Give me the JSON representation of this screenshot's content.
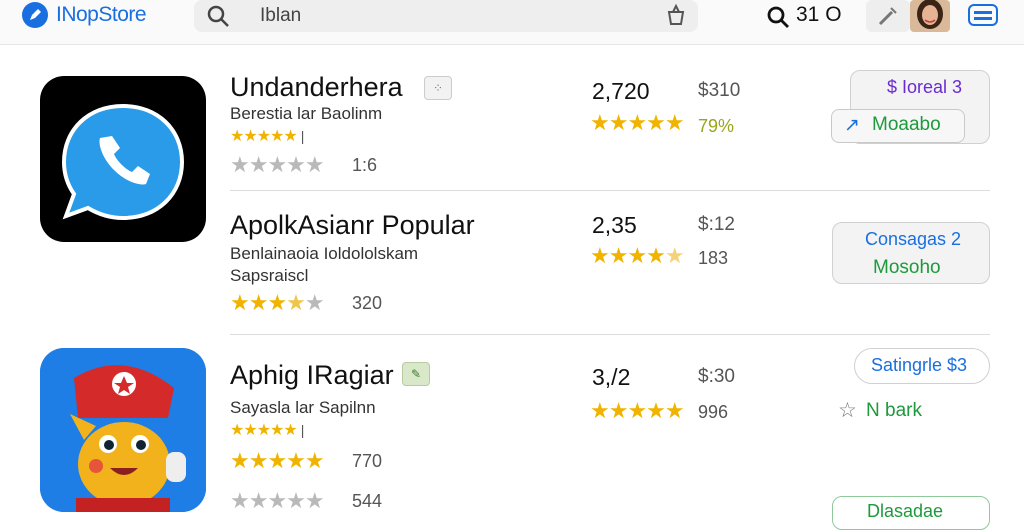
{
  "header": {
    "brand": "INopStore",
    "search": {
      "value": "Iblan"
    },
    "count": "31 O"
  },
  "apps": [
    {
      "name": "Undanderhera",
      "subtitle": "Berestia lar Baolinm",
      "small_stars": "★★★★★",
      "small_stars_extra": "|",
      "grey_stars": "★★★★★",
      "rating_count": "1:6",
      "metric": "2,720",
      "price": "$310",
      "big_stars": "★★★★★",
      "percent": "79%",
      "secondary_button": "$ Ioreal 3",
      "primary_button": "Moaabo"
    },
    {
      "name": "ApolkAsianr Popular",
      "subtitle": "Benlainaoia Ioldololskam",
      "subtitle2": "Sapsraiscl",
      "stars_filled": "★★★",
      "stars_half": "★",
      "stars_empty": "★",
      "rating_count": "320",
      "metric": "2,35",
      "price": "$:12",
      "big_stars_filled": "★★★★",
      "big_stars_half": "★",
      "sub_count": "183",
      "button_line1": "Consagas 2",
      "button_line2": "Mosoho"
    },
    {
      "name": "Aphig IRagiar",
      "subtitle": "Sayasla lar Sapilnn",
      "small_stars": "★★★★★",
      "small_stars_extra": "|",
      "stars_filled": "★★★★★",
      "rating_count": "770",
      "metric": "3,/2",
      "price": "$:30",
      "big_stars": "★★★★★",
      "sub_count": "996",
      "button_top": "Satingrle $3",
      "secondary_label": "N bark",
      "grey_stars": "★★★★★",
      "rating_count2": "544",
      "button_bottom": "Dlasadae"
    }
  ],
  "colors": {
    "accent": "#1a6fe0",
    "star": "#f0b400",
    "green": "#1e9a3c",
    "purple": "#6a2bd0"
  }
}
